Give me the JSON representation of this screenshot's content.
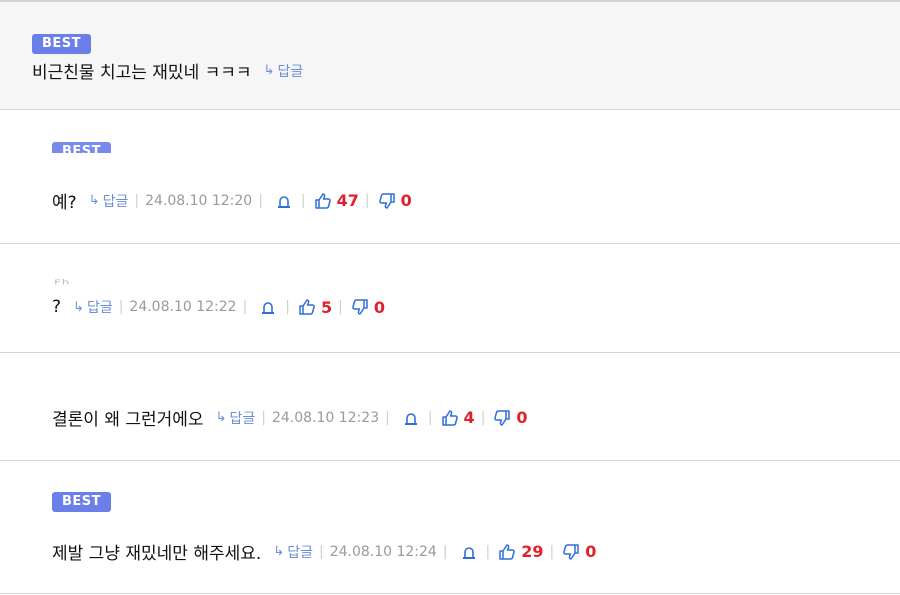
{
  "best_label": "BEST",
  "reply_label": "답글",
  "top_comment": {
    "text": "비근친물 치고는 재밌네 ㅋㅋㅋ"
  },
  "comments": [
    {
      "author": "",
      "text": "예?",
      "date": "24.08.10 12:20",
      "likes": "47",
      "dislikes": "0"
    },
    {
      "author": "Fh",
      "text": "?",
      "date": "24.08.10 12:22",
      "likes": "5",
      "dislikes": "0"
    },
    {
      "author": "",
      "text": "결론이 왜 그런거에오",
      "date": "24.08.10 12:23",
      "likes": "4",
      "dislikes": "0"
    },
    {
      "author": "",
      "text": "제발 그냥 재밌네만 해주세요.",
      "date": "24.08.10 12:24",
      "likes": "29",
      "dislikes": "0"
    }
  ],
  "colors": {
    "badge": "#6b7fe8",
    "reply": "#6c8fd8",
    "count": "#e1212b",
    "icon": "#2f6fdb"
  },
  "icons": {
    "reply": "reply-arrow-icon",
    "report": "siren-icon",
    "like": "thumbs-up-icon",
    "dislike": "thumbs-down-icon"
  }
}
